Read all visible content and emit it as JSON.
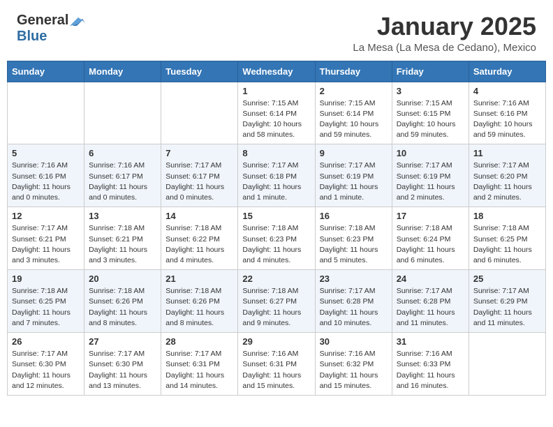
{
  "header": {
    "logo_general": "General",
    "logo_blue": "Blue",
    "month_title": "January 2025",
    "location": "La Mesa (La Mesa de Cedano), Mexico"
  },
  "weekdays": [
    "Sunday",
    "Monday",
    "Tuesday",
    "Wednesday",
    "Thursday",
    "Friday",
    "Saturday"
  ],
  "weeks": [
    [
      {
        "day": "",
        "info": ""
      },
      {
        "day": "",
        "info": ""
      },
      {
        "day": "",
        "info": ""
      },
      {
        "day": "1",
        "info": "Sunrise: 7:15 AM\nSunset: 6:14 PM\nDaylight: 10 hours\nand 58 minutes."
      },
      {
        "day": "2",
        "info": "Sunrise: 7:15 AM\nSunset: 6:14 PM\nDaylight: 10 hours\nand 59 minutes."
      },
      {
        "day": "3",
        "info": "Sunrise: 7:15 AM\nSunset: 6:15 PM\nDaylight: 10 hours\nand 59 minutes."
      },
      {
        "day": "4",
        "info": "Sunrise: 7:16 AM\nSunset: 6:16 PM\nDaylight: 10 hours\nand 59 minutes."
      }
    ],
    [
      {
        "day": "5",
        "info": "Sunrise: 7:16 AM\nSunset: 6:16 PM\nDaylight: 11 hours\nand 0 minutes."
      },
      {
        "day": "6",
        "info": "Sunrise: 7:16 AM\nSunset: 6:17 PM\nDaylight: 11 hours\nand 0 minutes."
      },
      {
        "day": "7",
        "info": "Sunrise: 7:17 AM\nSunset: 6:17 PM\nDaylight: 11 hours\nand 0 minutes."
      },
      {
        "day": "8",
        "info": "Sunrise: 7:17 AM\nSunset: 6:18 PM\nDaylight: 11 hours\nand 1 minute."
      },
      {
        "day": "9",
        "info": "Sunrise: 7:17 AM\nSunset: 6:19 PM\nDaylight: 11 hours\nand 1 minute."
      },
      {
        "day": "10",
        "info": "Sunrise: 7:17 AM\nSunset: 6:19 PM\nDaylight: 11 hours\nand 2 minutes."
      },
      {
        "day": "11",
        "info": "Sunrise: 7:17 AM\nSunset: 6:20 PM\nDaylight: 11 hours\nand 2 minutes."
      }
    ],
    [
      {
        "day": "12",
        "info": "Sunrise: 7:17 AM\nSunset: 6:21 PM\nDaylight: 11 hours\nand 3 minutes."
      },
      {
        "day": "13",
        "info": "Sunrise: 7:18 AM\nSunset: 6:21 PM\nDaylight: 11 hours\nand 3 minutes."
      },
      {
        "day": "14",
        "info": "Sunrise: 7:18 AM\nSunset: 6:22 PM\nDaylight: 11 hours\nand 4 minutes."
      },
      {
        "day": "15",
        "info": "Sunrise: 7:18 AM\nSunset: 6:23 PM\nDaylight: 11 hours\nand 4 minutes."
      },
      {
        "day": "16",
        "info": "Sunrise: 7:18 AM\nSunset: 6:23 PM\nDaylight: 11 hours\nand 5 minutes."
      },
      {
        "day": "17",
        "info": "Sunrise: 7:18 AM\nSunset: 6:24 PM\nDaylight: 11 hours\nand 6 minutes."
      },
      {
        "day": "18",
        "info": "Sunrise: 7:18 AM\nSunset: 6:25 PM\nDaylight: 11 hours\nand 6 minutes."
      }
    ],
    [
      {
        "day": "19",
        "info": "Sunrise: 7:18 AM\nSunset: 6:25 PM\nDaylight: 11 hours\nand 7 minutes."
      },
      {
        "day": "20",
        "info": "Sunrise: 7:18 AM\nSunset: 6:26 PM\nDaylight: 11 hours\nand 8 minutes."
      },
      {
        "day": "21",
        "info": "Sunrise: 7:18 AM\nSunset: 6:26 PM\nDaylight: 11 hours\nand 8 minutes."
      },
      {
        "day": "22",
        "info": "Sunrise: 7:18 AM\nSunset: 6:27 PM\nDaylight: 11 hours\nand 9 minutes."
      },
      {
        "day": "23",
        "info": "Sunrise: 7:17 AM\nSunset: 6:28 PM\nDaylight: 11 hours\nand 10 minutes."
      },
      {
        "day": "24",
        "info": "Sunrise: 7:17 AM\nSunset: 6:28 PM\nDaylight: 11 hours\nand 11 minutes."
      },
      {
        "day": "25",
        "info": "Sunrise: 7:17 AM\nSunset: 6:29 PM\nDaylight: 11 hours\nand 11 minutes."
      }
    ],
    [
      {
        "day": "26",
        "info": "Sunrise: 7:17 AM\nSunset: 6:30 PM\nDaylight: 11 hours\nand 12 minutes."
      },
      {
        "day": "27",
        "info": "Sunrise: 7:17 AM\nSunset: 6:30 PM\nDaylight: 11 hours\nand 13 minutes."
      },
      {
        "day": "28",
        "info": "Sunrise: 7:17 AM\nSunset: 6:31 PM\nDaylight: 11 hours\nand 14 minutes."
      },
      {
        "day": "29",
        "info": "Sunrise: 7:16 AM\nSunset: 6:31 PM\nDaylight: 11 hours\nand 15 minutes."
      },
      {
        "day": "30",
        "info": "Sunrise: 7:16 AM\nSunset: 6:32 PM\nDaylight: 11 hours\nand 15 minutes."
      },
      {
        "day": "31",
        "info": "Sunrise: 7:16 AM\nSunset: 6:33 PM\nDaylight: 11 hours\nand 16 minutes."
      },
      {
        "day": "",
        "info": ""
      }
    ]
  ]
}
